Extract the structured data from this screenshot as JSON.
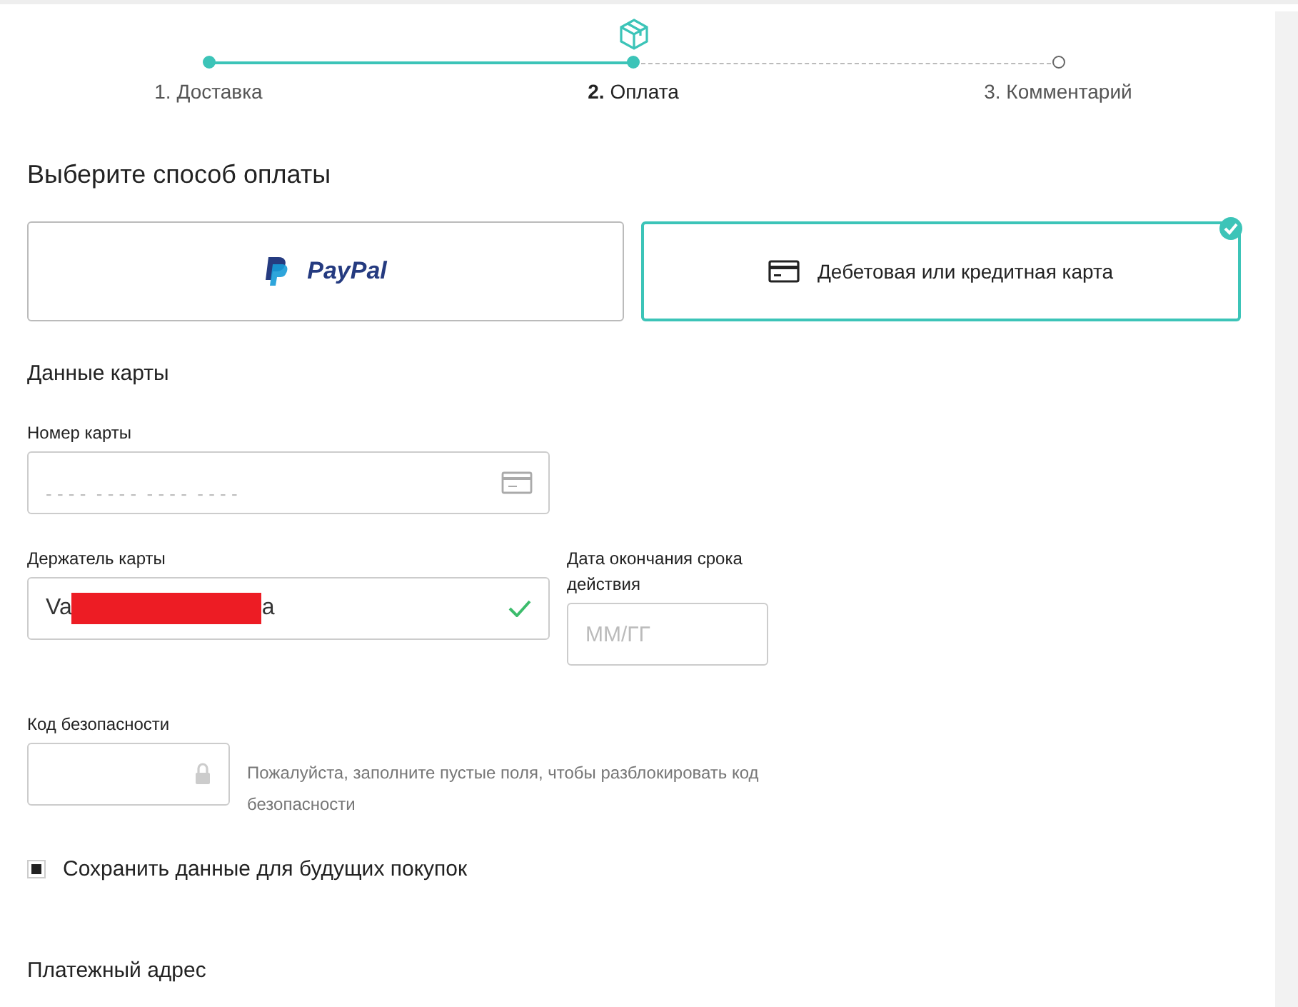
{
  "steps": [
    {
      "number": "1.",
      "label": "Доставка",
      "completed": true,
      "current": false
    },
    {
      "number": "2.",
      "label": "Оплата",
      "completed": true,
      "current": true
    },
    {
      "number": "3.",
      "label": "Комментарий",
      "completed": false,
      "current": false
    }
  ],
  "title": "Выберите способ оплаты",
  "methods": [
    {
      "kind": "paypal",
      "label": "PayPal",
      "selected": false
    },
    {
      "kind": "card",
      "label": "Дебетовая или кредитная карта",
      "selected": true
    }
  ],
  "card_section": "Данные карты",
  "card_number": {
    "label": "Номер карты",
    "placeholder": "- - - -  - - - -  - - - -  - - - -"
  },
  "holder": {
    "label": "Держатель карты",
    "value_start": "Va",
    "value_end": "a",
    "redacted": true,
    "valid": true
  },
  "expiry": {
    "label": "Дата окончания срока действия",
    "placeholder": "ММ/ГГ"
  },
  "cvc": {
    "label": "Код безопасности",
    "locked": true,
    "hint": "Пожалуйста, заполните пустые поля, чтобы разблокировать код безопасности"
  },
  "save": {
    "label": "Сохранить данные для будущих покупок",
    "checked": true
  },
  "billing": "Платежный адрес"
}
